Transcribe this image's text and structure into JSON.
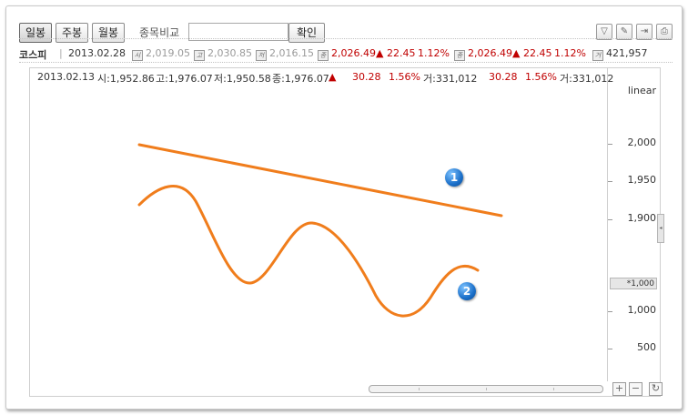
{
  "toolbar": {
    "tabs": [
      "일봉",
      "주봉",
      "월봉"
    ],
    "compare_label": "종목비교",
    "compare_value": "",
    "confirm_label": "확인",
    "tool_icons": [
      "filter-icon",
      "edit-icon",
      "expand-icon",
      "print-icon"
    ]
  },
  "info": {
    "name": "코스피",
    "date": "2013.02.28",
    "open_label": "시",
    "open": "2,019.05",
    "high_label": "고",
    "high": "2,030.85",
    "low_label": "저",
    "low": "2,016.15",
    "close_label": "종",
    "close": "2,026.49",
    "change": "▲ 22.45",
    "pct": "1.12%",
    "close2_label": "종",
    "close2": "2,026.49",
    "change2": "▲ 22.45",
    "pct2": "1.12%",
    "volume_label": "거",
    "volume": "421,957"
  },
  "ohlc": {
    "date": "2013.02.13",
    "open": "시:1,952.86",
    "high": "고:1,976.07",
    "low": "저:1,950.58",
    "close": "종:1,976.07",
    "arrow": "▲",
    "change": "30.28",
    "pct": "1.56%",
    "volume": "거:331,012",
    "change2": "30.28",
    "pct2": "1.56%",
    "volume2": "거:331,012"
  },
  "axis": {
    "scale": "linear",
    "ticks": [
      "2,000",
      "1,950",
      "1,900",
      "1,000",
      "500"
    ],
    "current_badge": "*1,000"
  },
  "annotations": {
    "marker_1": "1",
    "marker_2": "2",
    "line_color": "#f07d1c",
    "marker_color": "#1a6fc9"
  },
  "colors": {
    "up": "#c00000"
  }
}
